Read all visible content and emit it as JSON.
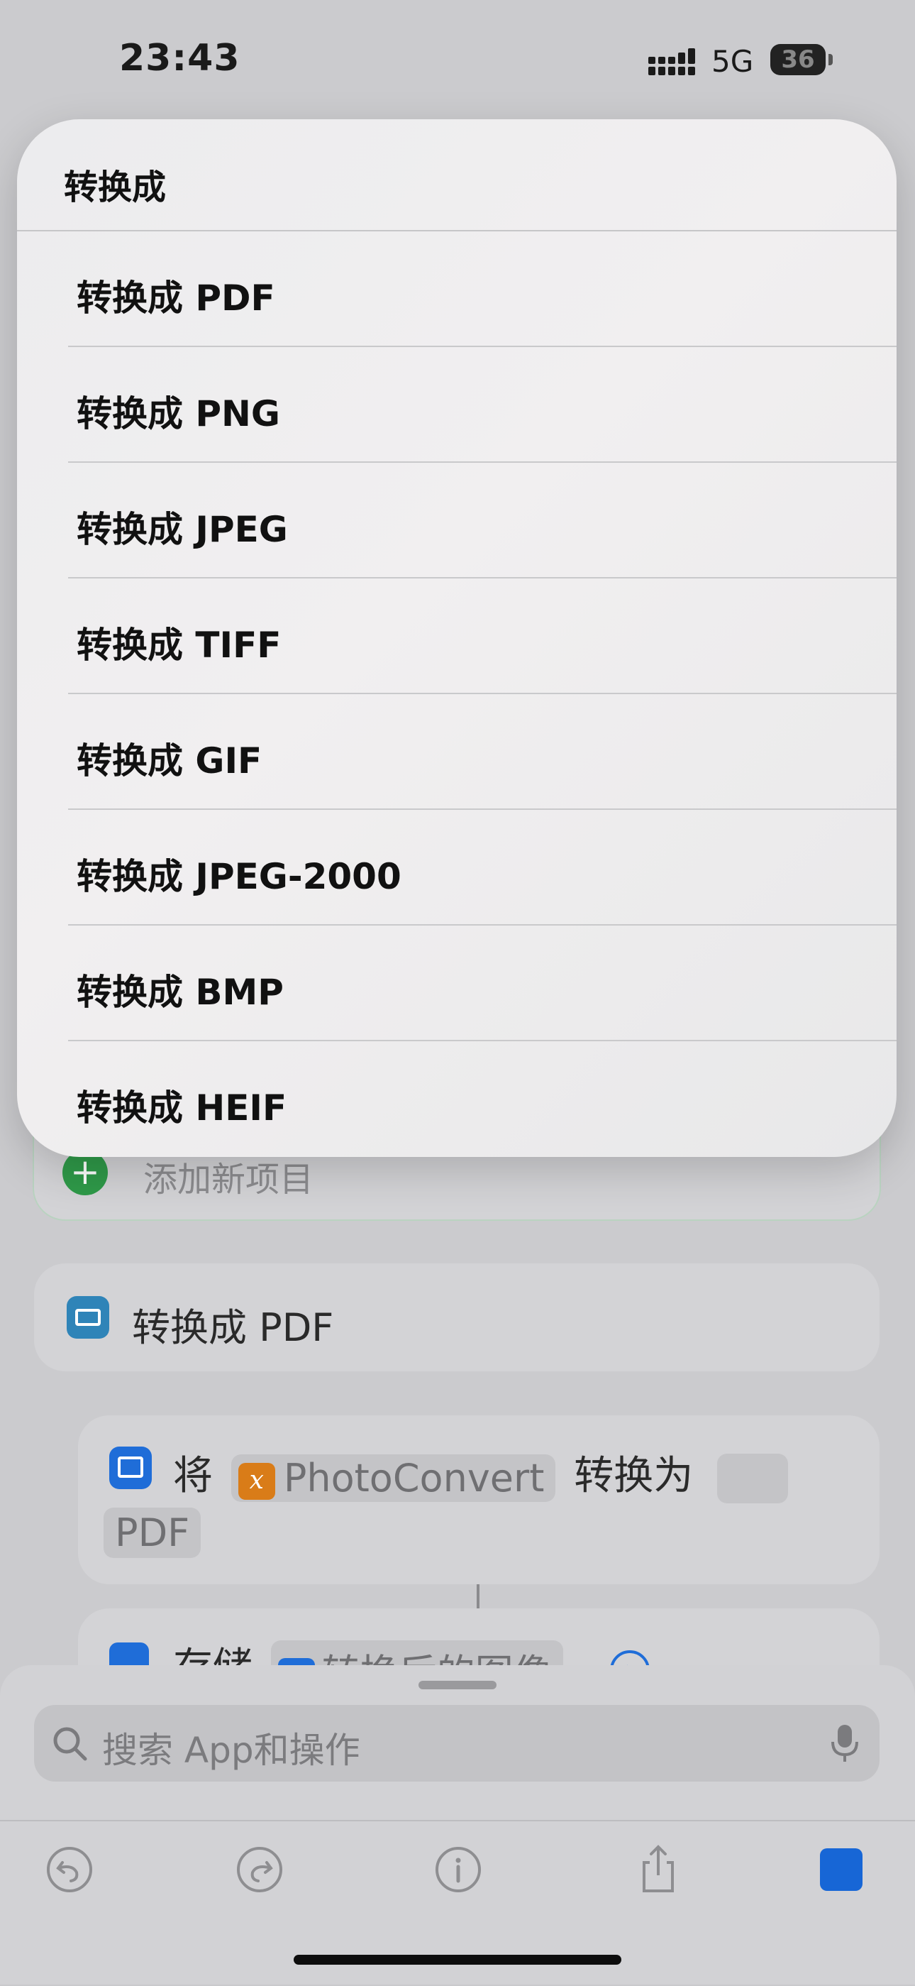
{
  "status_bar": {
    "time": "23:43",
    "network": "5G",
    "battery": "36"
  },
  "menu": {
    "title": "转换成",
    "items": [
      {
        "label": "转换成 PDF"
      },
      {
        "label": "转换成 PNG"
      },
      {
        "label": "转换成 JPEG"
      },
      {
        "label": "转换成 TIFF"
      },
      {
        "label": "转换成 GIF"
      },
      {
        "label": "转换成 JPEG-2000"
      },
      {
        "label": "转换成 BMP"
      },
      {
        "label": "转换成 HEIF"
      }
    ]
  },
  "editor": {
    "add_item_label": "添加新项目",
    "action_title": "转换成 PDF",
    "param": {
      "prefix": "将",
      "variable_badge": "x",
      "variable": "PhotoConvert",
      "middle": "转换为",
      "format": "PDF"
    },
    "save": {
      "verb": "存储",
      "token": "转换后的图像"
    }
  },
  "bottom_sheet": {
    "search_placeholder": "搜索 App和操作"
  },
  "colors": {
    "accent": "#1766d6",
    "variable": "#d97c18",
    "add_green": "#2f9a49"
  }
}
